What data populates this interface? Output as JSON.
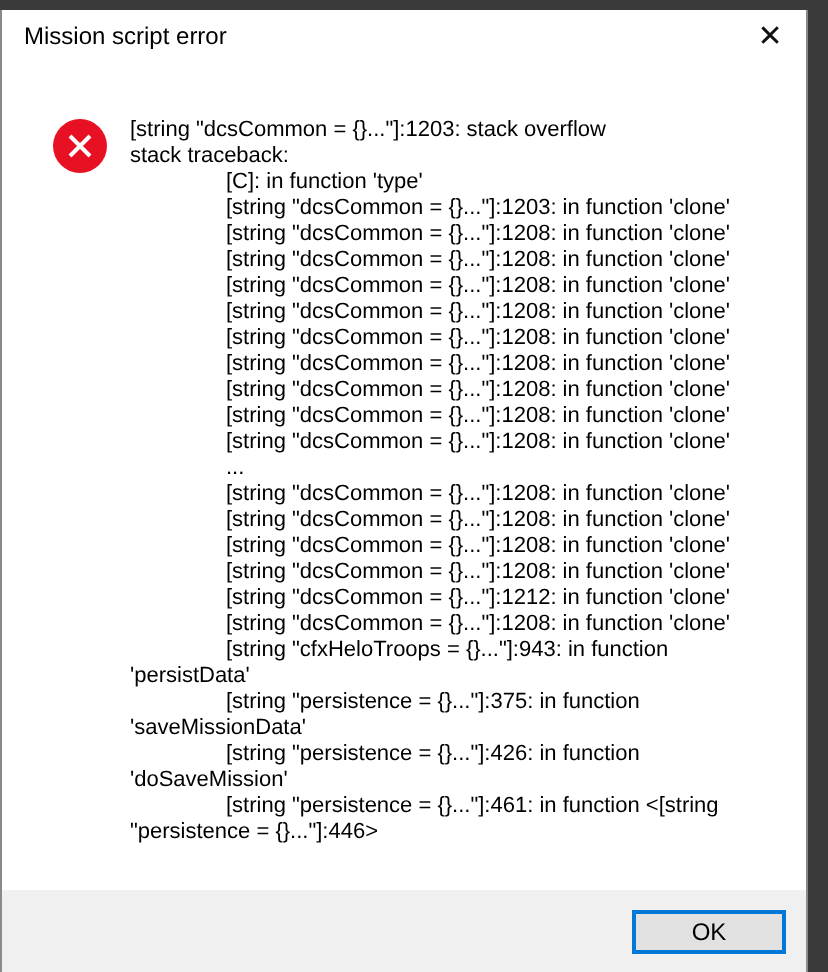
{
  "window": {
    "title": "Mission script error",
    "close": "✕"
  },
  "message": {
    "lines": [
      {
        "kind": "head",
        "text": "[string \"dcsCommon = {}...\"]:1203: stack overflow"
      },
      {
        "kind": "head",
        "text": "stack traceback:"
      },
      {
        "kind": "frame",
        "text": "[C]: in function 'type'"
      },
      {
        "kind": "frame",
        "text": "[string \"dcsCommon = {}...\"]:1203: in function 'clone'"
      },
      {
        "kind": "frame",
        "text": "[string \"dcsCommon = {}...\"]:1208: in function 'clone'"
      },
      {
        "kind": "frame",
        "text": "[string \"dcsCommon = {}...\"]:1208: in function 'clone'"
      },
      {
        "kind": "frame",
        "text": "[string \"dcsCommon = {}...\"]:1208: in function 'clone'"
      },
      {
        "kind": "frame",
        "text": "[string \"dcsCommon = {}...\"]:1208: in function 'clone'"
      },
      {
        "kind": "frame",
        "text": "[string \"dcsCommon = {}...\"]:1208: in function 'clone'"
      },
      {
        "kind": "frame",
        "text": "[string \"dcsCommon = {}...\"]:1208: in function 'clone'"
      },
      {
        "kind": "frame",
        "text": "[string \"dcsCommon = {}...\"]:1208: in function 'clone'"
      },
      {
        "kind": "frame",
        "text": "[string \"dcsCommon = {}...\"]:1208: in function 'clone'"
      },
      {
        "kind": "frame",
        "text": "[string \"dcsCommon = {}...\"]:1208: in function 'clone'"
      },
      {
        "kind": "frame",
        "text": "..."
      },
      {
        "kind": "frame",
        "text": "[string \"dcsCommon = {}...\"]:1208: in function 'clone'"
      },
      {
        "kind": "frame",
        "text": "[string \"dcsCommon = {}...\"]:1208: in function 'clone'"
      },
      {
        "kind": "frame",
        "text": "[string \"dcsCommon = {}...\"]:1208: in function 'clone'"
      },
      {
        "kind": "frame",
        "text": "[string \"dcsCommon = {}...\"]:1208: in function 'clone'"
      },
      {
        "kind": "frame",
        "text": "[string \"dcsCommon = {}...\"]:1212: in function 'clone'"
      },
      {
        "kind": "frame",
        "text": "[string \"dcsCommon = {}...\"]:1208: in function 'clone'"
      },
      {
        "kind": "frame",
        "text": "[string \"cfxHeloTroops = {}...\"]:943: in function"
      },
      {
        "kind": "head",
        "text": "'persistData'"
      },
      {
        "kind": "frame",
        "text": "[string \"persistence = {}...\"]:375: in function"
      },
      {
        "kind": "head",
        "text": "'saveMissionData'"
      },
      {
        "kind": "frame",
        "text": "[string \"persistence = {}...\"]:426: in function"
      },
      {
        "kind": "head",
        "text": "'doSaveMission'"
      },
      {
        "kind": "frame",
        "text": "[string \"persistence = {}...\"]:461: in function <[string"
      },
      {
        "kind": "head",
        "text": "\"persistence = {}...\"]:446>"
      }
    ]
  },
  "buttons": [
    {
      "label": "OK",
      "default": true
    }
  ]
}
